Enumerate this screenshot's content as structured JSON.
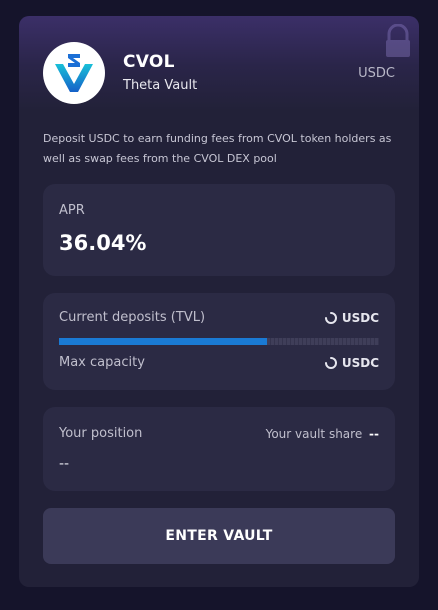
{
  "vault": {
    "name": "CVOL",
    "type": "Theta Vault",
    "asset": "USDC",
    "logo_icon": "cvol-logo-icon",
    "description": "Deposit USDC to earn funding fees from CVOL token holders as well as swap fees from the CVOL DEX pool"
  },
  "apr": {
    "label": "APR",
    "value": "36.04%"
  },
  "deposits": {
    "current_label": "Current deposits (TVL)",
    "current_unit": "USDC",
    "max_label": "Max capacity",
    "max_unit": "USDC",
    "progress_fraction": 0.65,
    "accent_color": "#1a7ad4"
  },
  "position": {
    "label": "Your position",
    "share_label": "Your vault share",
    "share_value": "--",
    "value": "--"
  },
  "actions": {
    "enter_label": "ENTER VAULT"
  }
}
